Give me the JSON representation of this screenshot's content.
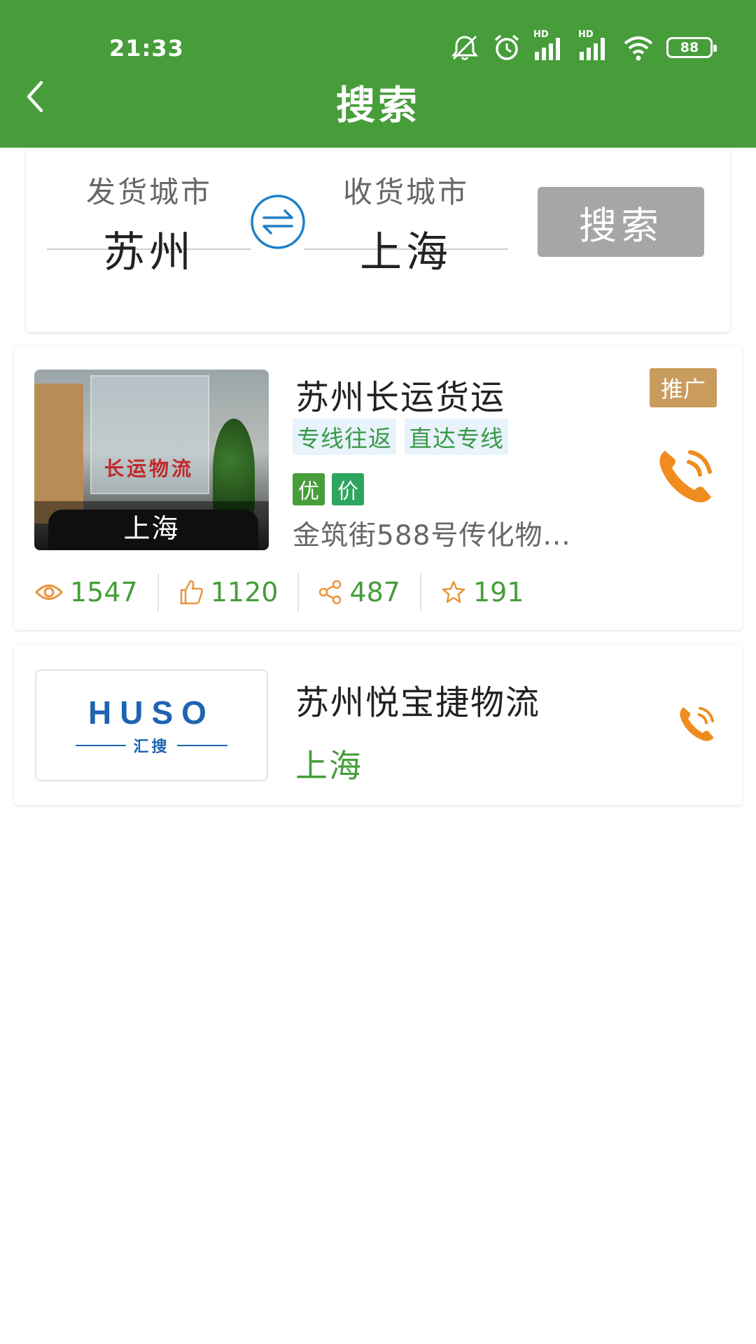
{
  "status_bar": {
    "time": "21:33",
    "hd_label": "HD",
    "battery": "88",
    "icons": [
      "mute-icon",
      "alarm-icon",
      "signal-icon",
      "signal-icon",
      "wifi-icon",
      "battery-icon"
    ]
  },
  "header": {
    "title": "搜索",
    "back_icon": "chevron-left-icon",
    "background": "#469d3a"
  },
  "search": {
    "from_label": "发货城市",
    "from_value": "苏州",
    "to_label": "收货城市",
    "to_value": "上海",
    "swap_icon": "swap-arrows-icon",
    "button_label": "搜索",
    "button_color": "#a6a6a6"
  },
  "results": [
    {
      "name": "苏州长运货运",
      "photo_city": "上海",
      "photo_sign": "长运物流",
      "promo_badge": "推广",
      "route_tags": [
        "专线往返",
        "直达专线"
      ],
      "feature_tags": [
        "优",
        "价"
      ],
      "address": "金筑街588号传化物...",
      "phone_icon": "phone-icon",
      "stats": {
        "views": "1547",
        "likes": "1120",
        "shares": "487",
        "favorites": "191"
      }
    },
    {
      "name": "苏州悦宝捷物流",
      "logo_text": "HUSO",
      "logo_sub": "汇搜",
      "city": "上海",
      "phone_icon": "phone-icon"
    }
  ],
  "colors": {
    "primary_green": "#469d3a",
    "accent_orange": "#f08c1e",
    "promo_gold": "#c99b5d",
    "logo_blue": "#1e64b0"
  }
}
